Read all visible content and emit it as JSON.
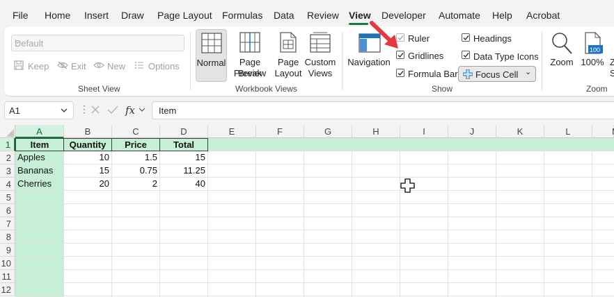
{
  "menu": {
    "items": [
      "File",
      "Home",
      "Insert",
      "Draw",
      "Page Layout",
      "Formulas",
      "Data",
      "Review",
      "View",
      "Developer",
      "Automate",
      "Help",
      "Acrobat"
    ],
    "active": "View"
  },
  "ribbon": {
    "sheet_view": {
      "dropdown_value": "Default",
      "keep_label": "Keep",
      "exit_label": "Exit",
      "new_label": "New",
      "options_label": "Options",
      "group_label": "Sheet View"
    },
    "workbook_views": {
      "normal_label": "Normal",
      "page_break_label_1": "Page Break",
      "page_break_label_2": "Preview",
      "page_layout_label_1": "Page",
      "page_layout_label_2": "Layout",
      "custom_views_label_1": "Custom",
      "custom_views_label_2": "Views",
      "group_label": "Workbook Views"
    },
    "show": {
      "navigation_label": "Navigation",
      "ruler_label": "Ruler",
      "ruler_checked": true,
      "ruler_disabled": true,
      "gridlines_label": "Gridlines",
      "gridlines_checked": true,
      "formula_bar_label": "Formula Bar",
      "formula_bar_checked": true,
      "headings_label": "Headings",
      "headings_checked": true,
      "data_type_icons_label": "Data Type Icons",
      "data_type_icons_checked": true,
      "focus_cell_label": "Focus Cell",
      "group_label": "Show"
    },
    "zoom": {
      "zoom_label": "Zoom",
      "hundred_label": "100%",
      "hundred_badge": "100",
      "zoom_to_selection_partial_1": "Z",
      "zoom_to_selection_partial_2": "S",
      "group_label": "Zoom"
    }
  },
  "formula_bar": {
    "name_box": "A1",
    "fx_label": "fx",
    "content": "Item"
  },
  "sheet": {
    "columns": [
      "A",
      "B",
      "C",
      "D",
      "E",
      "F",
      "G",
      "H",
      "I",
      "J",
      "K",
      "L",
      "M"
    ],
    "rows": [
      "1",
      "2",
      "3",
      "4",
      "5",
      "6",
      "7",
      "8",
      "9",
      "10",
      "11",
      "12"
    ],
    "header": [
      "Item",
      "Quantity",
      "Price",
      "Total"
    ],
    "data": [
      [
        "Apples",
        "10",
        "1.5",
        "15"
      ],
      [
        "Bananas",
        "15",
        "0.75",
        "11.25"
      ],
      [
        "Cherries",
        "20",
        "2",
        "40"
      ]
    ]
  },
  "colors": {
    "accent": "#107c41",
    "selection_fill": "#c6efd8",
    "annotation_arrow": "#e8383d"
  }
}
